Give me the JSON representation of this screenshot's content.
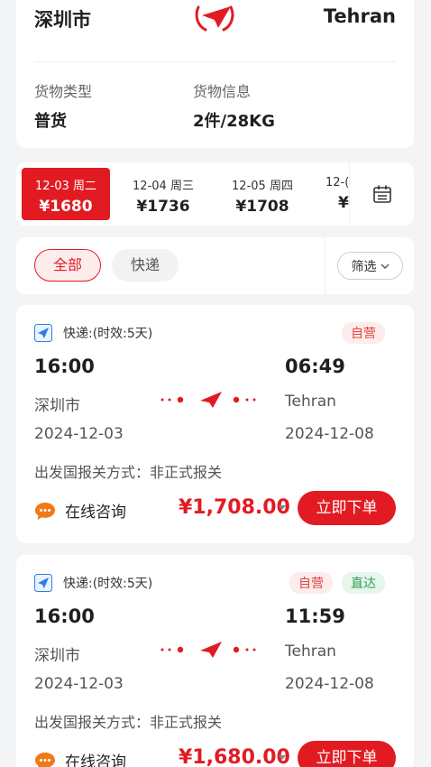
{
  "route": {
    "from": "深圳市",
    "to": "Tehran",
    "cargo_type_label": "货物类型",
    "cargo_type_value": "普货",
    "cargo_info_label": "货物信息",
    "cargo_info_value": "2件/28KG"
  },
  "dates": [
    {
      "date": "12-03 周二",
      "price": "¥1680",
      "active": true
    },
    {
      "date": "12-04 周三",
      "price": "¥1736",
      "active": false
    },
    {
      "date": "12-05 周四",
      "price": "¥1708",
      "active": false
    },
    {
      "date": "12-(",
      "price": "¥",
      "active": false
    }
  ],
  "filter": {
    "all_label": "全部",
    "express_label": "快递",
    "filter_label": "筛选"
  },
  "flights": [
    {
      "service": "快递:(时效:5天)",
      "badges": [
        "自营"
      ],
      "depart_time": "16:00",
      "arrive_time": "06:49",
      "from_city": "深圳市",
      "to_city": "Tehran",
      "depart_date": "2024-12-03",
      "arrive_date": "2024-12-08",
      "customs": "出发国报关方式：非正式报关",
      "consult_label": "在线咨询",
      "price": "¥1,708.00",
      "order_label": "立即下单"
    },
    {
      "service": "快递:(时效:5天)",
      "badges": [
        "自营",
        "直达"
      ],
      "depart_time": "16:00",
      "arrive_time": "11:59",
      "from_city": "深圳市",
      "to_city": "Tehran",
      "depart_date": "2024-12-03",
      "arrive_date": "2024-12-08",
      "customs": "出发国报关方式：非正式报关",
      "consult_label": "在线咨询",
      "price": "¥1,680.00",
      "order_label": "立即下单"
    }
  ],
  "colors": {
    "accent": "#e21b23",
    "badge_ziying_bg": "#fdecec",
    "badge_zhida_bg": "#e6f6ea",
    "consult_icon": "#ef7a1a",
    "service_icon": "#2b7de9"
  },
  "icons": {
    "logo": "red-paper-plane-logo",
    "calendar": "calendar-icon",
    "chevron": "chevron-down-icon",
    "service": "paper-plane-icon",
    "consult": "chat-bubble-icon",
    "path": "plane-route-icon"
  }
}
